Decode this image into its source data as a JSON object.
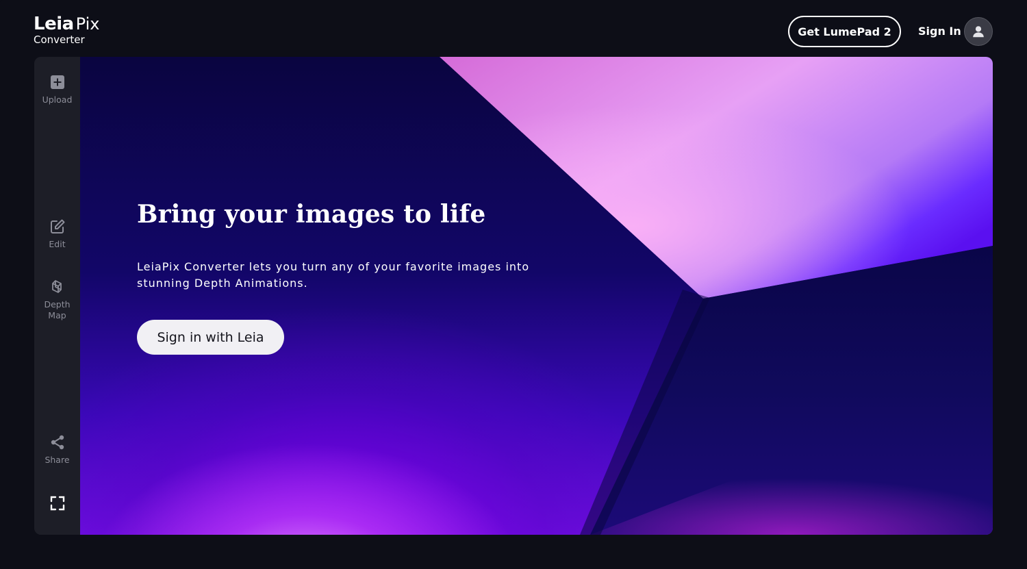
{
  "header": {
    "logo_leia": "Leia",
    "logo_pix": "Pix",
    "logo_sub": "Converter",
    "lumepad_button": "Get LumePad 2",
    "signin_link": "Sign In",
    "avatar_icon": "user-icon"
  },
  "sidebar": {
    "items": [
      {
        "label": "Upload",
        "icon": "plus-square-icon"
      },
      {
        "label": "Edit",
        "icon": "edit-icon"
      },
      {
        "label": "Depth\nMap",
        "icon": "depth-map-icon"
      },
      {
        "label": "Share",
        "icon": "share-icon"
      },
      {
        "label": "",
        "icon": "fullscreen-icon"
      }
    ]
  },
  "hero": {
    "title": "Bring your images to life",
    "text": "LeiaPix Converter lets you turn any of your favorite images into stunning Depth Animations.",
    "button": "Sign in with Leia"
  },
  "colors": {
    "page_bg": "#0d0e17",
    "sidebar_bg": "#1d1e27",
    "sidebar_text": "#8d8e99",
    "hero_dark": "#0a0540",
    "hero_violet": "#6e0fe0",
    "hero_pink": "#f0a8f5",
    "button_bg": "#f1f0f4"
  }
}
